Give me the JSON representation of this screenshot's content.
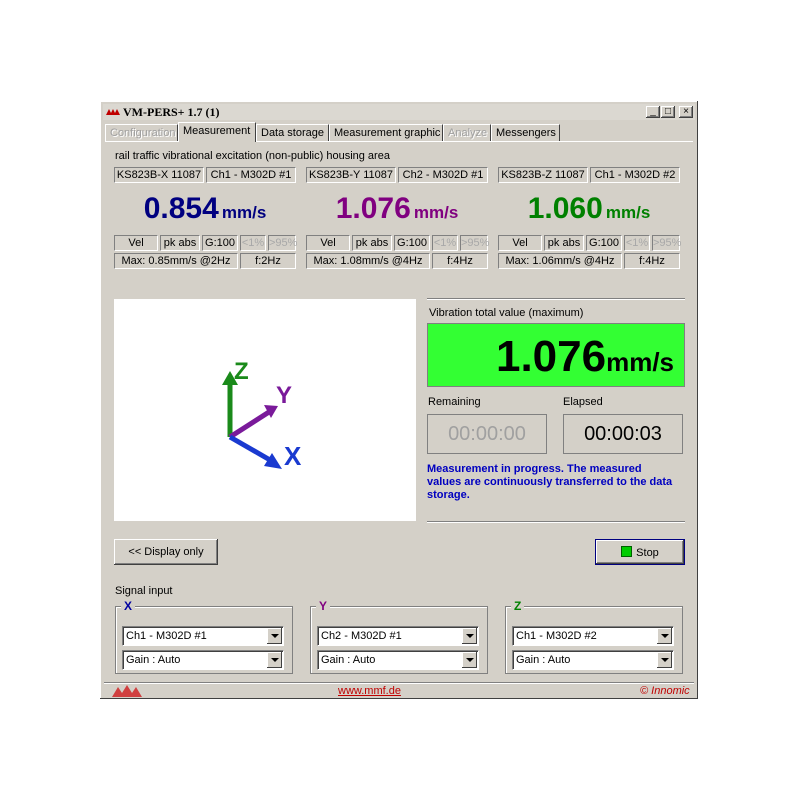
{
  "window": {
    "title": "VM-PERS+ 1.7 (1)",
    "minimize": "_",
    "maximize": "□",
    "close": "×"
  },
  "tabs": [
    {
      "label": "Configuration",
      "disabled": true
    },
    {
      "label": "Measurement",
      "active": true
    },
    {
      "label": "Data storage"
    },
    {
      "label": "Measurement graphic"
    },
    {
      "label": "Analyze",
      "disabled": true
    },
    {
      "label": "Messengers"
    }
  ],
  "location": "rail traffic vibrational excitation (non-public) housing area",
  "channels": [
    {
      "sensor": "KS823B-X 11087",
      "ch": "Ch1 - M302D #1",
      "value": "0.854",
      "unit": "mm/s",
      "color": "#000080",
      "mode": "Vel",
      "peak": "pk abs",
      "gain": "G:100",
      "lt": "<1%",
      "gt": ">95%",
      "max": "Max: 0.85mm/s @2Hz",
      "freq": "f:2Hz"
    },
    {
      "sensor": "KS823B-Y 11087",
      "ch": "Ch2 - M302D #1",
      "value": "1.076",
      "unit": "mm/s",
      "color": "#800080",
      "mode": "Vel",
      "peak": "pk abs",
      "gain": "G:100",
      "lt": "<1%",
      "gt": ">95%",
      "max": "Max: 1.08mm/s @4Hz",
      "freq": "f:4Hz"
    },
    {
      "sensor": "KS823B-Z 11087",
      "ch": "Ch1 - M302D #2",
      "value": "1.060",
      "unit": "mm/s",
      "color": "#008000",
      "mode": "Vel",
      "peak": "pk abs",
      "gain": "G:100",
      "lt": "<1%",
      "gt": ">95%",
      "max": "Max: 1.06mm/s @4Hz",
      "freq": "f:4Hz"
    }
  ],
  "axes": {
    "x": "X",
    "y": "Y",
    "z": "Z"
  },
  "total": {
    "label": "Vibration total value (maximum)",
    "value": "1.076",
    "unit": "mm/s",
    "color": "#33ff33"
  },
  "timers": {
    "remaining_label": "Remaining",
    "remaining": "00:00:00",
    "elapsed_label": "Elapsed",
    "elapsed": "00:00:03"
  },
  "status": "Measurement in progress. The measured values are continuously transferred to the data storage.",
  "buttons": {
    "display_only": "<< Display only",
    "stop": "Stop"
  },
  "signal_input": {
    "label": "Signal input",
    "groups": [
      {
        "axis": "X",
        "channel": "Ch1 - M302D #1",
        "gain": "Gain : Auto"
      },
      {
        "axis": "Y",
        "channel": "Ch2 - M302D #1",
        "gain": "Gain : Auto"
      },
      {
        "axis": "Z",
        "channel": "Ch1 - M302D #2",
        "gain": "Gain : Auto"
      }
    ]
  },
  "footer": {
    "url": "www.mmf.de",
    "copyright": "© Innomic"
  }
}
